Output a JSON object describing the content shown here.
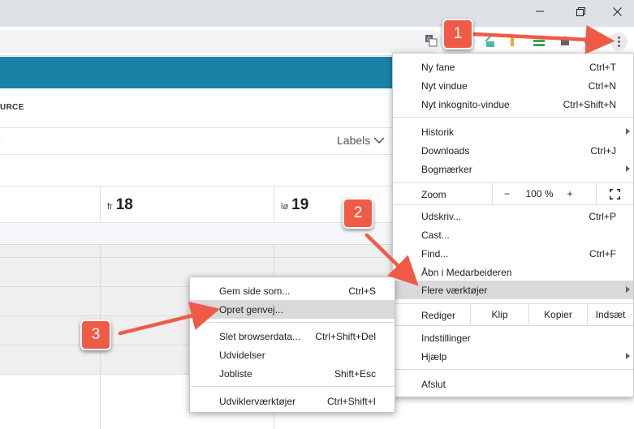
{
  "window_controls": {
    "minimize_icon": "minimize-icon",
    "restore_icon": "restore-icon",
    "close_icon": "close-icon"
  },
  "background_app": {
    "section_label": "URCE",
    "filter_caret": "‹",
    "labels_button": "Labels",
    "days": [
      {
        "name": "fr",
        "date": "18"
      },
      {
        "name": "lø",
        "date": "19"
      }
    ],
    "colors": {
      "header": "#1a82a6"
    }
  },
  "menu": {
    "new_tab": {
      "label": "Ny fane",
      "shortcut": "Ctrl+T"
    },
    "new_window": {
      "label": "Nyt vindue",
      "shortcut": "Ctrl+N"
    },
    "incognito": {
      "label": "Nyt inkognito-vindue",
      "shortcut": "Ctrl+Shift+N"
    },
    "history": {
      "label": "Historik"
    },
    "downloads": {
      "label": "Downloads",
      "shortcut": "Ctrl+J"
    },
    "bookmarks": {
      "label": "Bogmærker"
    },
    "zoom": {
      "label": "Zoom",
      "minus": "−",
      "value": "100 %",
      "plus": "+"
    },
    "print": {
      "label": "Udskriv...",
      "shortcut": "Ctrl+P"
    },
    "cast": {
      "label": "Cast..."
    },
    "find": {
      "label": "Find...",
      "shortcut": "Ctrl+F"
    },
    "open_in": {
      "label": "Åbn i Medarbeideren"
    },
    "more_tools": {
      "label": "Flere værktøjer"
    },
    "edit": {
      "label": "Rediger",
      "cut": "Klip",
      "copy": "Kopier",
      "paste": "Indsæt"
    },
    "settings": {
      "label": "Indstillinger"
    },
    "help": {
      "label": "Hjælp"
    },
    "exit": {
      "label": "Afslut"
    }
  },
  "submenu": {
    "save_page": {
      "label": "Gem side som...",
      "shortcut": "Ctrl+S"
    },
    "create_shortcut": {
      "label": "Opret genvej..."
    },
    "clear_data": {
      "label": "Slet browserdata...",
      "shortcut": "Ctrl+Shift+Del"
    },
    "extensions": {
      "label": "Udvidelser"
    },
    "task_manager": {
      "label": "Jobliste",
      "shortcut": "Shift+Esc"
    },
    "devtools": {
      "label": "Udviklerværktøjer",
      "shortcut": "Ctrl+Shift+I"
    }
  },
  "annotations": {
    "steps": [
      "1",
      "2",
      "3"
    ],
    "color": "#f05b47"
  }
}
